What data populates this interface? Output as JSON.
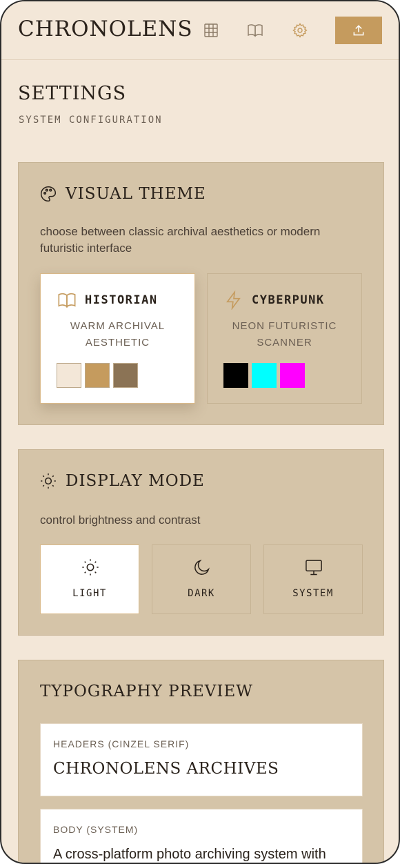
{
  "header": {
    "brand": "CHRONOLENS",
    "nav_icons": [
      "grid-icon",
      "book-icon",
      "gear-icon"
    ],
    "upload_icon": "upload-icon",
    "accent": "#c59b5e"
  },
  "page": {
    "title": "SETTINGS",
    "subtitle": "SYSTEM CONFIGURATION"
  },
  "visual_theme": {
    "title": "VISUAL THEME",
    "icon": "palette-icon",
    "description": "choose between classic archival aesthetics or modern futuristic interface",
    "selected": "historian",
    "options": [
      {
        "id": "historian",
        "name": "HISTORIAN",
        "icon": "book-open-icon",
        "description": "WARM ARCHIVAL AESTHETIC",
        "swatches": [
          "#f3e7d8",
          "#c59b5e",
          "#8b7355"
        ]
      },
      {
        "id": "cyberpunk",
        "name": "CYBERPUNK",
        "icon": "lightning-icon",
        "description": "NEON FUTURISTIC SCANNER",
        "swatches": [
          "#000000",
          "#00ffff",
          "#ff00ff"
        ]
      }
    ]
  },
  "display_mode": {
    "title": "DISPLAY MODE",
    "icon": "sun-icon",
    "description": "control brightness and contrast",
    "selected": "light",
    "options": [
      {
        "id": "light",
        "label": "LIGHT",
        "icon": "sun-icon"
      },
      {
        "id": "dark",
        "label": "DARK",
        "icon": "moon-icon"
      },
      {
        "id": "system",
        "label": "SYSTEM",
        "icon": "monitor-icon"
      }
    ]
  },
  "typography": {
    "title": "TYPOGRAPHY PREVIEW",
    "headers_label": "HEADERS (CINZEL SERIF)",
    "headers_sample": "CHRONOLENS ARCHIVES",
    "body_label": "BODY (SYSTEM)",
    "body_sample": "A cross-platform photo archiving system with"
  }
}
